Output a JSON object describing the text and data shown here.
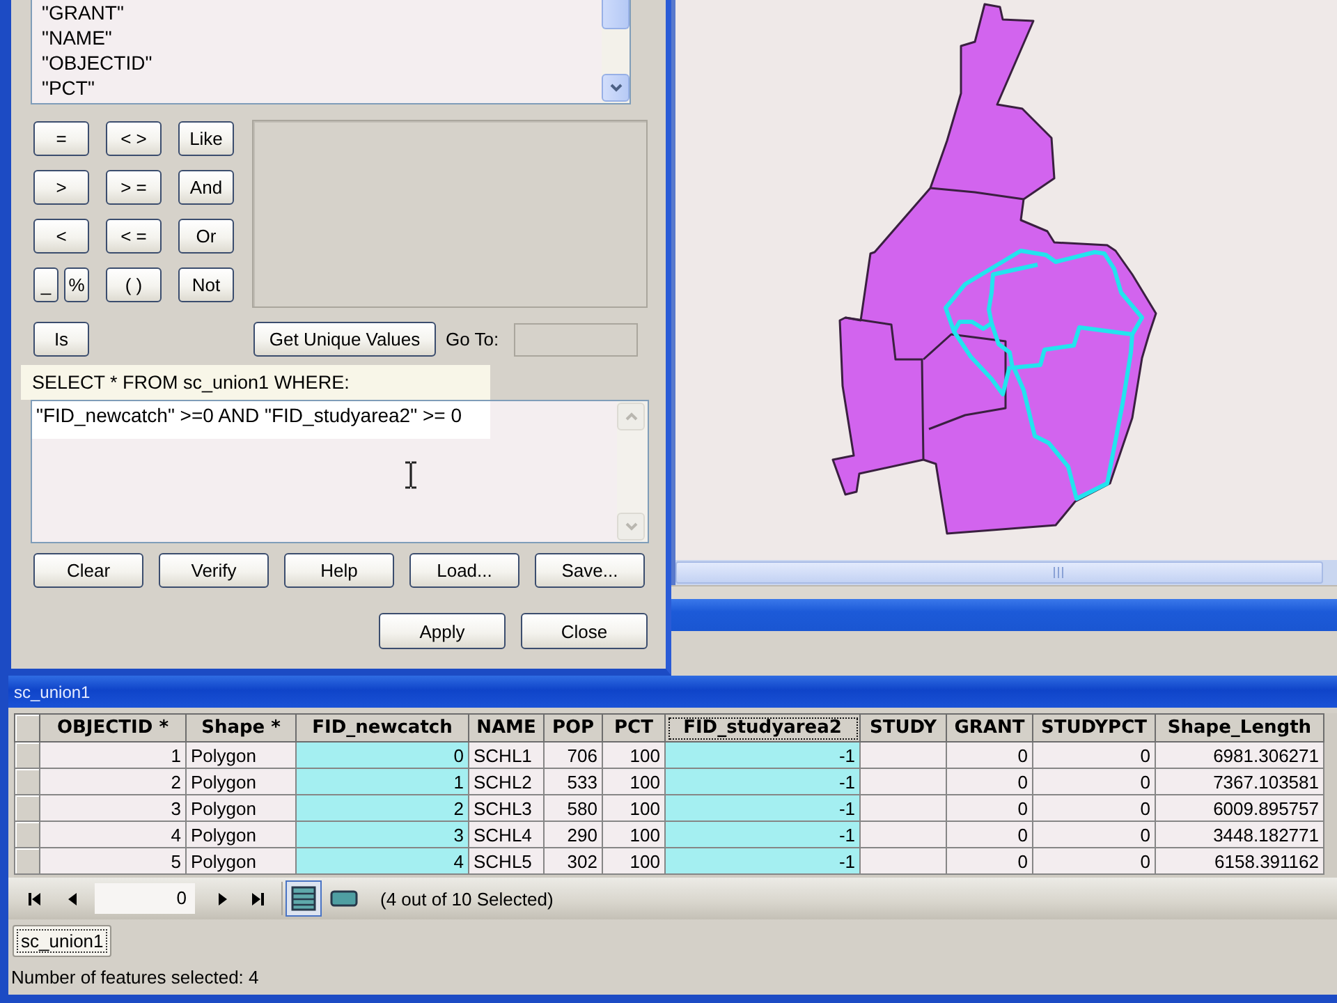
{
  "query_dialog": {
    "field_list": [
      "\"GRANT\"",
      "\"NAME\"",
      "\"OBJECTID\"",
      "\"PCT\""
    ],
    "operator_rows": [
      [
        "=",
        "< >",
        "Like"
      ],
      [
        ">",
        "> =",
        "And"
      ],
      [
        "<",
        "< =",
        "Or"
      ],
      [
        "_",
        "%",
        "( )",
        "Not"
      ],
      [
        "Is"
      ]
    ],
    "unique_values_button": "Get Unique Values",
    "go_to_label": "Go To:",
    "sql_prefix": "SELECT * FROM sc_union1 WHERE:",
    "expression": "\"FID_newcatch\" >=0 AND \"FID_studyarea2\" >= 0",
    "expression_buttons": [
      "Clear",
      "Verify",
      "Help",
      "Load...",
      "Save..."
    ],
    "dialog_buttons": [
      "Apply",
      "Close"
    ]
  },
  "attribute_table": {
    "title": "sc_union1",
    "columns": [
      {
        "label": "OBJECTID *",
        "kind": "number",
        "selected": false,
        "focused": false
      },
      {
        "label": "Shape *",
        "kind": "text",
        "selected": false,
        "focused": false
      },
      {
        "label": "FID_newcatch",
        "kind": "number",
        "selected": true,
        "focused": false
      },
      {
        "label": "NAME",
        "kind": "text",
        "selected": false,
        "focused": false
      },
      {
        "label": "POP",
        "kind": "number",
        "selected": false,
        "focused": false
      },
      {
        "label": "PCT",
        "kind": "number",
        "selected": false,
        "focused": false
      },
      {
        "label": "FID_studyarea2",
        "kind": "number",
        "selected": true,
        "focused": true
      },
      {
        "label": "STUDY",
        "kind": "text",
        "selected": false,
        "focused": false
      },
      {
        "label": "GRANT",
        "kind": "number",
        "selected": false,
        "focused": false
      },
      {
        "label": "STUDYPCT",
        "kind": "number",
        "selected": false,
        "focused": false
      },
      {
        "label": "Shape_Length",
        "kind": "number",
        "selected": false,
        "focused": false
      }
    ],
    "rows": [
      [
        "1",
        "Polygon",
        "0",
        "SCHL1",
        "706",
        "100",
        "-1",
        null,
        "0",
        "0",
        "6981.306271"
      ],
      [
        "2",
        "Polygon",
        "1",
        "SCHL2",
        "533",
        "100",
        "-1",
        null,
        "0",
        "0",
        "7367.103581"
      ],
      [
        "3",
        "Polygon",
        "2",
        "SCHL3",
        "580",
        "100",
        "-1",
        null,
        "0",
        "0",
        "6009.895757"
      ],
      [
        "4",
        "Polygon",
        "3",
        "SCHL4",
        "290",
        "100",
        "-1",
        null,
        "0",
        "0",
        "3448.182771"
      ],
      [
        "5",
        "Polygon",
        "4",
        "SCHL5",
        "302",
        "100",
        "-1",
        null,
        "0",
        "0",
        "6158.391162"
      ]
    ],
    "navigator": {
      "record": "0",
      "view_buttons": [
        {
          "kind": "all_records",
          "selected": true
        },
        {
          "kind": "selected_records",
          "selected": false
        }
      ],
      "selection_count": "(4 out of 10 Selected)"
    },
    "tabs": [
      {
        "label": "sc_union1",
        "selected": true
      }
    ]
  },
  "status_bar": "Number of features selected: 4"
}
